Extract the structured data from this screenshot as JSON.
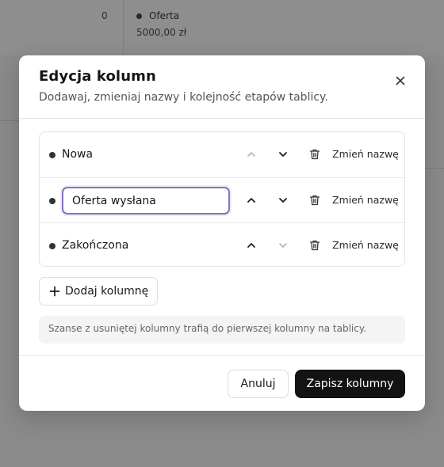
{
  "background": {
    "column_count": "0",
    "card": {
      "title": "Oferta",
      "price": "5000,00 zł"
    }
  },
  "modal": {
    "title": "Edycja kolumn",
    "subtitle": "Dodawaj, zmieniaj nazwy i kolejność etapów tablicy.",
    "close_icon": "close-icon",
    "columns": [
      {
        "name": "Nowa",
        "editing": false,
        "up_enabled": false,
        "down_enabled": true
      },
      {
        "name": "Oferta wysłana",
        "editing": true,
        "up_enabled": true,
        "down_enabled": true
      },
      {
        "name": "Zakończona",
        "editing": false,
        "up_enabled": true,
        "down_enabled": false
      }
    ],
    "rename_label": "Zmień nazwę",
    "add_column_label": "Dodaj kolumnę",
    "info_text": "Szanse z usuniętej kolumny trafią do pierwszej kolumny na tablicy.",
    "cancel_label": "Anuluj",
    "save_label": "Zapisz kolumny"
  },
  "colors": {
    "overlay": "#8a8a8a",
    "primary_button": "#131313",
    "focus_border": "#8a70c6"
  }
}
